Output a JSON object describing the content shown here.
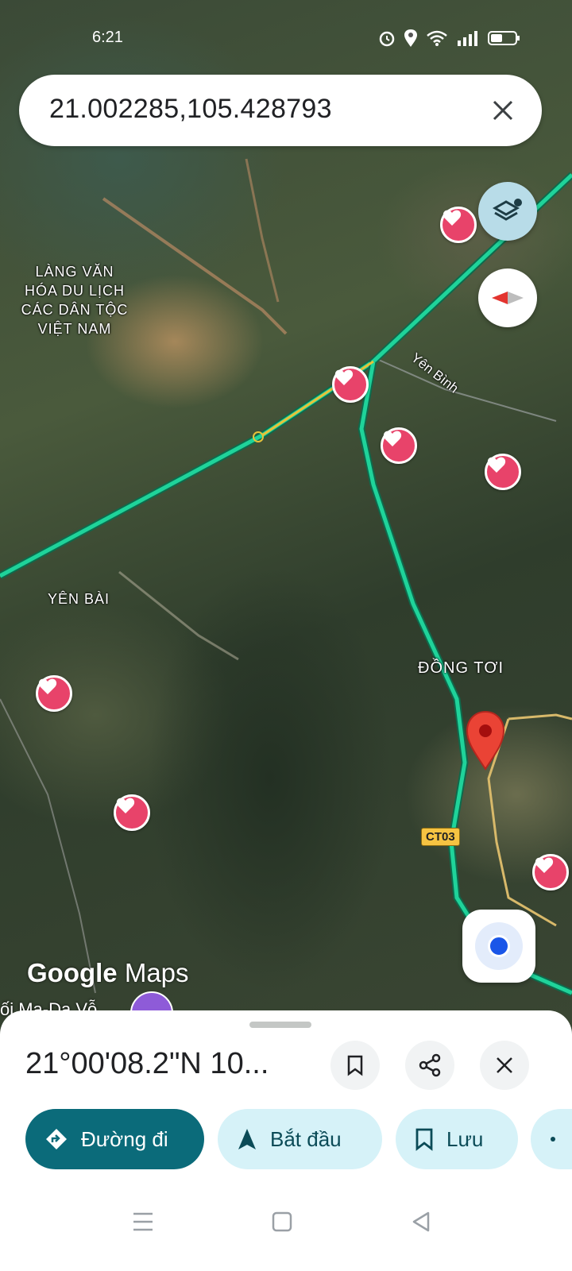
{
  "status_bar": {
    "time": "6:21"
  },
  "search": {
    "value": "21.002285,105.428793"
  },
  "map": {
    "labels": {
      "village_culture": [
        "LÀNG VĂN",
        "HÓA DU LỊCH",
        "CÁC DÂN TỘC",
        "VIỆT NAM"
      ],
      "yen_binh": "Yên Bình",
      "yen_bai": "YÊN BÀI",
      "dong_toi": "ĐỒNG TƠI",
      "road_shield": "CT03",
      "peek_text": "ối Ma-Dạ Vỗ"
    },
    "logo": {
      "brand": "Google",
      "product": "Maps"
    }
  },
  "place_sheet": {
    "title": "21°00'08.2\"N 10...",
    "actions": [
      {
        "label": "Đường đi",
        "icon": "directions-icon"
      },
      {
        "label": "Bắt đầu",
        "icon": "navigation-arrow-icon"
      },
      {
        "label": "Lưu",
        "icon": "bookmark-icon"
      }
    ]
  },
  "colors": {
    "primary_chip": "#0b6b7a",
    "secondary_chip": "#d6f2f8",
    "route": "#1fd39a",
    "pin": "#ea4335",
    "heart": "#e8436a",
    "layers_button": "#b8dce8"
  }
}
